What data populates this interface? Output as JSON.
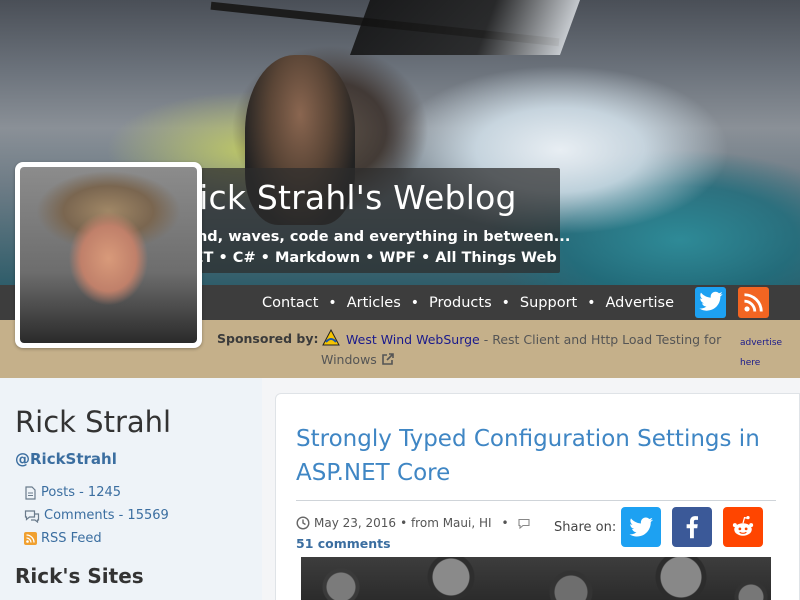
{
  "header": {
    "title": "Rick Strahl's Weblog",
    "tagline": "Wind, waves, code and everything in between...",
    "topics": ".NET • C# • Markdown • WPF • All Things Web"
  },
  "nav": {
    "items": [
      {
        "label": "Contact"
      },
      {
        "label": "Articles"
      },
      {
        "label": "Products"
      },
      {
        "label": "Support"
      },
      {
        "label": "Advertise"
      }
    ],
    "separator": "•",
    "icons": [
      "twitter-icon",
      "rss-icon"
    ]
  },
  "sponsor": {
    "label": "Sponsored by:",
    "link_text": "West Wind WebSurge",
    "description": " - Rest Client and Http Load Testing for Windows",
    "advertise_here": "advertise here"
  },
  "sidebar": {
    "author_name": "Rick Strahl",
    "handle": "@RickStrahl",
    "stats": {
      "posts": "Posts - 1245",
      "comments": "Comments - 15569",
      "rss": "RSS Feed"
    },
    "sites_title": "Rick's Sites"
  },
  "post": {
    "title": "Strongly Typed Configuration Settings in ASP.NET Core",
    "date": "May 23, 2016",
    "location": "• from Maui, HI",
    "meta_sep": "•",
    "comments": "51 comments",
    "share_label": "Share on:"
  },
  "colors": {
    "link": "#3f86c4",
    "nav_bg": "#3d3d3d",
    "sponsor_bg": "#c5b08a",
    "twitter": "#1da1f2",
    "facebook": "#3b5998",
    "reddit": "#ff4500",
    "rss": "#f26522"
  }
}
